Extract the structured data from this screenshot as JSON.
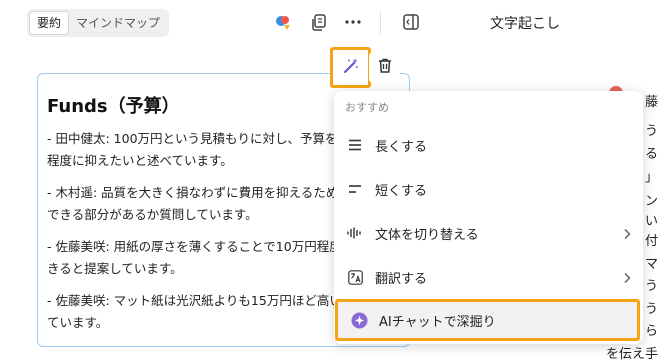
{
  "tabs": [
    {
      "label": "要約",
      "active": true
    },
    {
      "label": "マインドマップ",
      "active": false
    }
  ],
  "toolbar_icons": [
    "color-assistant-icon",
    "copy-icon",
    "more-icon",
    "sidebar-toggle-icon"
  ],
  "right_panel": {
    "title": "文字起こし",
    "fragments": [
      "藤",
      "う",
      "る",
      "」",
      "ン",
      "い",
      "付",
      "マ",
      "う",
      "う",
      "ら",
      "を伝え手"
    ]
  },
  "card": {
    "title": "Funds（予算）",
    "paragraphs": [
      "- 田中健太: 100万円という見積もりに対し、予算を80万円程度に抑えたいと述べています。",
      "- 木村遥: 品質を大きく損なわずに費用を抑えるため、調整できる部分があるか質問しています。",
      "- 佐藤美咲: 用紙の厚さを薄くすることで10万円程度削減できると提案しています。",
      "- 佐藤美咲: マット紙は光沢紙よりも15万円ほど高いと述べています。"
    ]
  },
  "menu": {
    "section": "おすすめ",
    "items": [
      {
        "label": "長くする",
        "icon": "lines-long-icon",
        "submenu": false
      },
      {
        "label": "短くする",
        "icon": "lines-short-icon",
        "submenu": false
      },
      {
        "label": "文体を切り替える",
        "icon": "soundwave-icon",
        "submenu": true
      },
      {
        "label": "翻訳する",
        "icon": "translate-icon",
        "submenu": true
      },
      {
        "label": "AIチャットで深掘り",
        "icon": "ai-chat-icon",
        "submenu": false,
        "highlighted": true
      }
    ]
  },
  "colors": {
    "highlight": "#f6a416",
    "card_border": "#9fcdf5",
    "accent_purple": "#8a6ad8"
  }
}
